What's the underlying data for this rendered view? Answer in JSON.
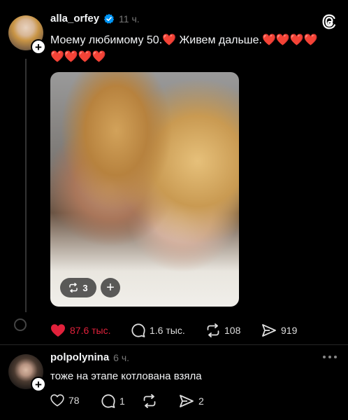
{
  "post": {
    "username": "alla_orfey",
    "time": "11 ч.",
    "text": "Моему любимому 50.",
    "text_after": " Живем дальше.",
    "photo": {
      "repost_count": "3"
    },
    "actions": {
      "likes": "87.6 тыс.",
      "replies": "1.6 тыс.",
      "reposts": "108",
      "shares": "919"
    }
  },
  "reply": {
    "username": "polpolynina",
    "time": "6 ч.",
    "text": "тоже на этапе котлована взяла",
    "actions": {
      "likes": "78",
      "replies": "1",
      "shares": "2"
    }
  },
  "colors": {
    "background": "#000000",
    "like_active": "#e1213b",
    "verified": "#0095f6",
    "muted": "#777777"
  },
  "icons": [
    "threads-logo-icon",
    "verified-badge-icon",
    "heart-icon",
    "comment-icon",
    "repost-icon",
    "share-icon",
    "more-icon",
    "plus-icon"
  ]
}
